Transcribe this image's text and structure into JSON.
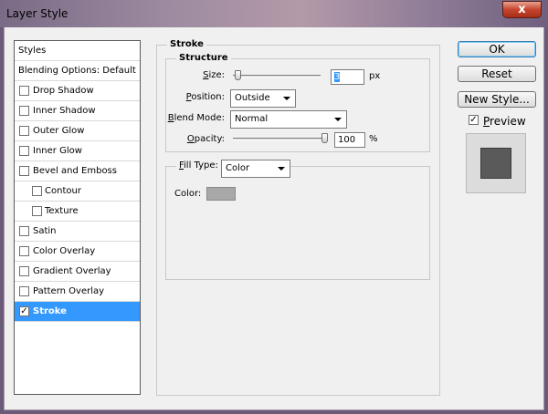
{
  "window": {
    "title": "Layer Style",
    "close_label": "x"
  },
  "styles_panel": {
    "items": [
      {
        "label": "Styles",
        "type": "header"
      },
      {
        "label": "Blending Options: Default",
        "type": "header"
      },
      {
        "label": "Drop Shadow",
        "checked": false,
        "indent": 0
      },
      {
        "label": "Inner Shadow",
        "checked": false,
        "indent": 0
      },
      {
        "label": "Outer Glow",
        "checked": false,
        "indent": 0
      },
      {
        "label": "Inner Glow",
        "checked": false,
        "indent": 0
      },
      {
        "label": "Bevel and Emboss",
        "checked": false,
        "indent": 0
      },
      {
        "label": "Contour",
        "checked": false,
        "indent": 1
      },
      {
        "label": "Texture",
        "checked": false,
        "indent": 1
      },
      {
        "label": "Satin",
        "checked": false,
        "indent": 0
      },
      {
        "label": "Color Overlay",
        "checked": false,
        "indent": 0
      },
      {
        "label": "Gradient Overlay",
        "checked": false,
        "indent": 0
      },
      {
        "label": "Pattern Overlay",
        "checked": false,
        "indent": 0
      },
      {
        "label": "Stroke",
        "checked": true,
        "indent": 0,
        "selected": true
      }
    ]
  },
  "stroke": {
    "title": "Stroke",
    "structure": {
      "title": "Structure",
      "size_label_u": "S",
      "size_label_rest": "ize:",
      "size_value": "3",
      "size_unit": "px",
      "size_slider": 0.02,
      "position_label_u": "P",
      "position_label_rest": "osition:",
      "position_value": "Outside",
      "blend_mode_label_u": "B",
      "blend_mode_label_rest": "lend Mode:",
      "blend_mode_value": "Normal",
      "opacity_label_u": "O",
      "opacity_label_rest": "pacity:",
      "opacity_value": "100",
      "opacity_unit": "%",
      "opacity_slider": 1.0
    },
    "fill": {
      "fill_type_label_u": "F",
      "fill_type_label_rest": "ill Type:",
      "fill_type_value": "Color",
      "color_label": "Color:",
      "color_swatch": "#a8a8a8"
    }
  },
  "buttons": {
    "ok": "OK",
    "reset": "Reset",
    "new_style": "New Style..."
  },
  "preview": {
    "label": "Preview",
    "checked": true,
    "swatch_color": "#5a5a5a"
  },
  "colors": {
    "selection": "#3399ff"
  }
}
